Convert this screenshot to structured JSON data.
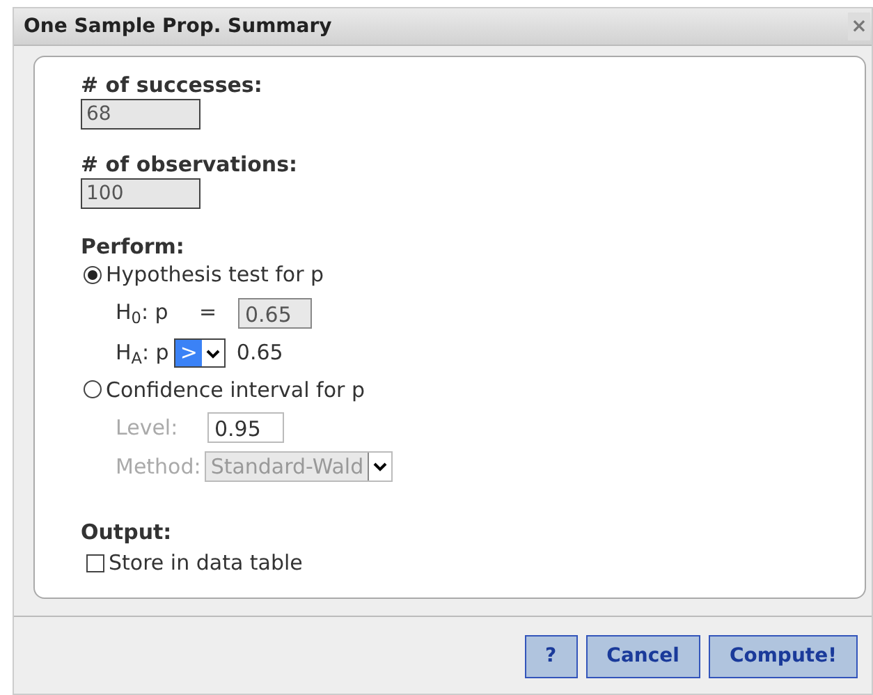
{
  "window": {
    "title": "One Sample Prop. Summary",
    "close": "×"
  },
  "fields": [
    {
      "label": "# of successes:",
      "value": "68"
    },
    {
      "label": "# of observations:",
      "value": "100"
    }
  ],
  "perform": {
    "label": "Perform:",
    "options": [
      {
        "kind": "test",
        "label": "Hypothesis test for p",
        "selected": true,
        "disabled": false,
        "null_label": "H$_{0}$: p",
        "null_sign": "=",
        "null_value": "0.65",
        "alt_label": "H$_{A}$: p",
        "alt_sign": ">",
        "alt_value": "0.65"
      },
      {
        "kind": "interval",
        "label": "Confidence interval for p",
        "selected": false,
        "disabled": true,
        "level_label": "Level:",
        "level_value": "0.95",
        "method_label": "Method:",
        "method_value": "Standard-Wald"
      }
    ]
  },
  "output": {
    "label": "Output:",
    "store": {
      "label": "Store in data table",
      "checked": false
    }
  },
  "buttons": [
    "?",
    "Cancel",
    "Compute!"
  ]
}
